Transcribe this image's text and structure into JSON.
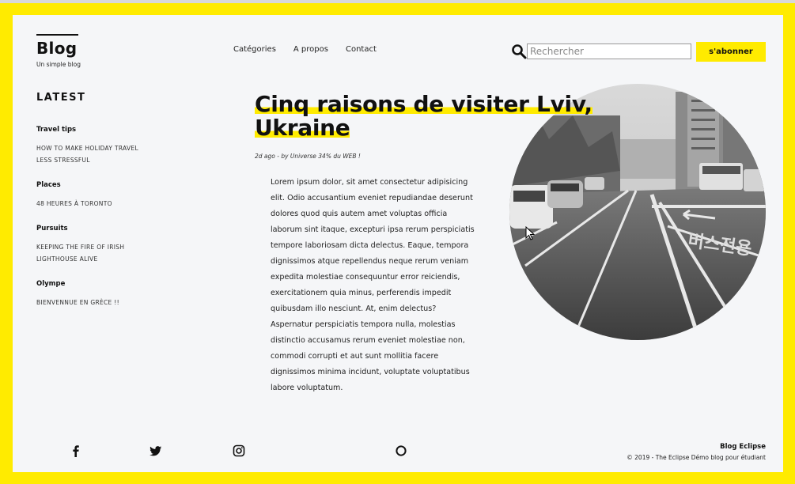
{
  "brand": {
    "title": "Blog",
    "subtitle": "Un simple blog"
  },
  "nav": {
    "items": [
      "Catégories",
      "A propos",
      "Contact"
    ]
  },
  "search": {
    "placeholder": "Rechercher",
    "icon": "search-icon"
  },
  "subscribe_label": "s'abonner",
  "sidebar": {
    "heading": "LATEST",
    "categories": [
      {
        "title": "Travel tips",
        "links": [
          "HOW TO MAKE HOLIDAY TRAVEL",
          "LESS STRESSFUL"
        ]
      },
      {
        "title": "Places",
        "links": [
          "48 HEURES À TORONTO"
        ]
      },
      {
        "title": "Pursuits",
        "links": [
          "KEEPING THE FIRE OF IRISH",
          "LIGHTHOUSE ALIVE"
        ]
      },
      {
        "title": "Olympe",
        "links": [
          "BIENVENNUE EN GRÈCE !!"
        ]
      }
    ]
  },
  "article": {
    "title_line1": "Cinq raisons de visiter Lviv,",
    "title_line2": "Ukraine",
    "meta": "2d ago - by Universe 34% du WEB !",
    "body": "Lorem ipsum dolor, sit amet consectetur adipisicing elit. Odio accusantium eveniet repudiandae deserunt dolores quod quis autem amet voluptas officia laborum sint itaque, excepturi ipsa rerum perspiciatis tempore laboriosam dicta delectus. Eaque, tempora dignissimos atque repellendus neque rerum veniam expedita molestiae consequuntur error reiciendis, exercitationem quia minus, perferendis impedit quibusdam illo nesciunt. At, enim delectus? Aspernatur perspiciatis tempora nulla, molestias distinctio accusamus rerum eveniet molestiae non, commodi corrupti et aut sunt mollitia facere dignissimos minima incidunt, voluptate voluptatibus labore voluptatum."
  },
  "footer": {
    "title": "Blog Eclipse",
    "copyright": "© 2019 - The Eclipse Démo blog pour étudiant",
    "social_icons": [
      "facebook-icon",
      "twitter-icon",
      "instagram-icon",
      "circle-icon"
    ]
  },
  "colors": {
    "accent": "#ffeb00",
    "page_bg": "#f5f6f8",
    "text": "#111111"
  }
}
